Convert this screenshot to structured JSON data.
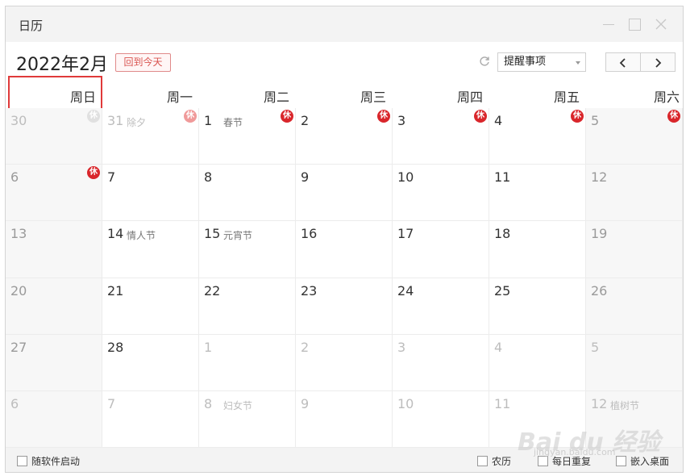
{
  "window": {
    "title": "日历"
  },
  "toolbar": {
    "month_title": "2022年2月",
    "today_button": "回到今天",
    "reminder_select": "提醒事项"
  },
  "weekdays": [
    "周日",
    "周一",
    "周二",
    "周三",
    "周四",
    "周五",
    "周六"
  ],
  "holiday_badge": "休",
  "weeks": [
    [
      {
        "day": "30",
        "lunar": "",
        "other": true,
        "badge": "ghost"
      },
      {
        "day": "31",
        "lunar": "除夕",
        "other": true,
        "badge": "faded"
      },
      {
        "day": "1",
        "lunar": "春节",
        "other": false,
        "badge": "full"
      },
      {
        "day": "2",
        "lunar": "",
        "other": false,
        "badge": "full"
      },
      {
        "day": "3",
        "lunar": "",
        "other": false,
        "badge": "full"
      },
      {
        "day": "4",
        "lunar": "",
        "other": false,
        "badge": "full"
      },
      {
        "day": "5",
        "lunar": "",
        "other": false,
        "badge": "full"
      }
    ],
    [
      {
        "day": "6",
        "lunar": "",
        "other": false,
        "badge": "full"
      },
      {
        "day": "7",
        "lunar": "",
        "other": false,
        "badge": ""
      },
      {
        "day": "8",
        "lunar": "",
        "other": false,
        "badge": ""
      },
      {
        "day": "9",
        "lunar": "",
        "other": false,
        "badge": ""
      },
      {
        "day": "10",
        "lunar": "",
        "other": false,
        "badge": ""
      },
      {
        "day": "11",
        "lunar": "",
        "other": false,
        "badge": ""
      },
      {
        "day": "12",
        "lunar": "",
        "other": false,
        "badge": ""
      }
    ],
    [
      {
        "day": "13",
        "lunar": "",
        "other": false,
        "badge": ""
      },
      {
        "day": "14",
        "lunar": "情人节",
        "other": false,
        "badge": ""
      },
      {
        "day": "15",
        "lunar": "元宵节",
        "other": false,
        "badge": ""
      },
      {
        "day": "16",
        "lunar": "",
        "other": false,
        "badge": ""
      },
      {
        "day": "17",
        "lunar": "",
        "other": false,
        "badge": ""
      },
      {
        "day": "18",
        "lunar": "",
        "other": false,
        "badge": ""
      },
      {
        "day": "19",
        "lunar": "",
        "other": false,
        "badge": ""
      }
    ],
    [
      {
        "day": "20",
        "lunar": "",
        "other": false,
        "badge": ""
      },
      {
        "day": "21",
        "lunar": "",
        "other": false,
        "badge": ""
      },
      {
        "day": "22",
        "lunar": "",
        "other": false,
        "badge": ""
      },
      {
        "day": "23",
        "lunar": "",
        "other": false,
        "badge": ""
      },
      {
        "day": "24",
        "lunar": "",
        "other": false,
        "badge": ""
      },
      {
        "day": "25",
        "lunar": "",
        "other": false,
        "badge": ""
      },
      {
        "day": "26",
        "lunar": "",
        "other": false,
        "badge": ""
      }
    ],
    [
      {
        "day": "27",
        "lunar": "",
        "other": false,
        "badge": ""
      },
      {
        "day": "28",
        "lunar": "",
        "other": false,
        "badge": ""
      },
      {
        "day": "1",
        "lunar": "",
        "other": true,
        "badge": ""
      },
      {
        "day": "2",
        "lunar": "",
        "other": true,
        "badge": ""
      },
      {
        "day": "3",
        "lunar": "",
        "other": true,
        "badge": ""
      },
      {
        "day": "4",
        "lunar": "",
        "other": true,
        "badge": ""
      },
      {
        "day": "5",
        "lunar": "",
        "other": true,
        "badge": ""
      }
    ],
    [
      {
        "day": "6",
        "lunar": "",
        "other": true,
        "badge": ""
      },
      {
        "day": "7",
        "lunar": "",
        "other": true,
        "badge": ""
      },
      {
        "day": "8",
        "lunar": "妇女节",
        "other": true,
        "badge": ""
      },
      {
        "day": "9",
        "lunar": "",
        "other": true,
        "badge": ""
      },
      {
        "day": "10",
        "lunar": "",
        "other": true,
        "badge": ""
      },
      {
        "day": "11",
        "lunar": "",
        "other": true,
        "badge": ""
      },
      {
        "day": "12",
        "lunar": "植树节",
        "other": true,
        "badge": ""
      }
    ]
  ],
  "statusbar": {
    "follow_startup": "随软件启动",
    "lunar": "农历",
    "daily_repeat": "每日重复",
    "embed_desktop": "嵌入桌面"
  },
  "watermark": {
    "brand": "Bai du 经验",
    "url": "jingyan.baidu.com"
  },
  "colors": {
    "accent": "#d9262b",
    "highlight_border": "#e03a3a"
  }
}
